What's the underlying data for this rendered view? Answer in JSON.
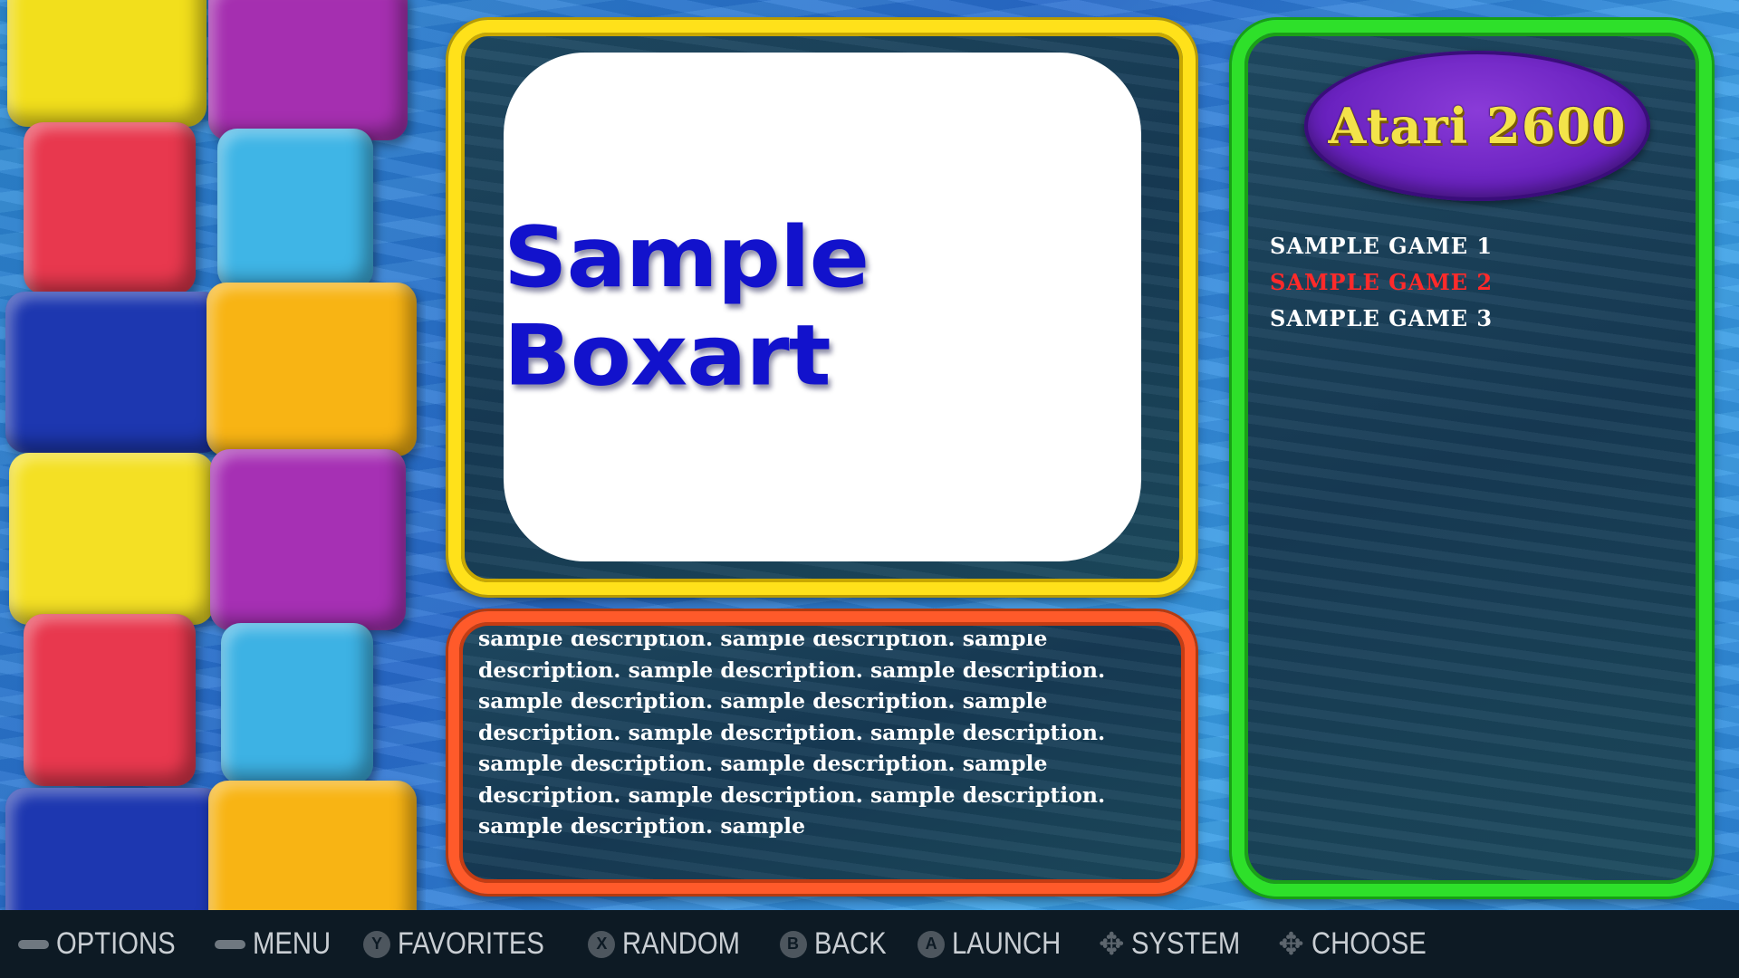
{
  "boxart": {
    "label": "Sample Boxart"
  },
  "description": {
    "text": "sample description. sample description. sample description. sample description. sample description. sample description. sample description. sample description. sample description. sample description. sample description. sample description. sample description. sample description. sample description. sample description. sample"
  },
  "system": {
    "logo_text": "Atari 2600"
  },
  "gamelist": {
    "items": [
      {
        "label": "SAMPLE GAME 1"
      },
      {
        "label": "SAMPLE GAME 2"
      },
      {
        "label": "SAMPLE GAME 3"
      }
    ],
    "selected_index": 1
  },
  "colors": {
    "boxart_frame": "#ffe11a",
    "description_frame": "#ff5a2a",
    "gamelist_frame": "#2ee02a",
    "selected_game": "#ff2a2a",
    "logo_background": "#6a22c0",
    "logo_text": "#f3e34a"
  },
  "help_bar": {
    "items": [
      {
        "icon": "select-button-icon",
        "label": "OPTIONS"
      },
      {
        "icon": "start-button-icon",
        "label": "MENU"
      },
      {
        "icon": "y-button-icon",
        "glyph": "Y",
        "label": "FAVORITES"
      },
      {
        "icon": "x-button-icon",
        "glyph": "X",
        "label": "RANDOM"
      },
      {
        "icon": "b-button-icon",
        "glyph": "B",
        "label": "BACK"
      },
      {
        "icon": "a-button-icon",
        "glyph": "A",
        "label": "LAUNCH"
      },
      {
        "icon": "dpad-icon",
        "label": "SYSTEM"
      },
      {
        "icon": "dpad-icon",
        "label": "CHOOSE"
      }
    ]
  }
}
